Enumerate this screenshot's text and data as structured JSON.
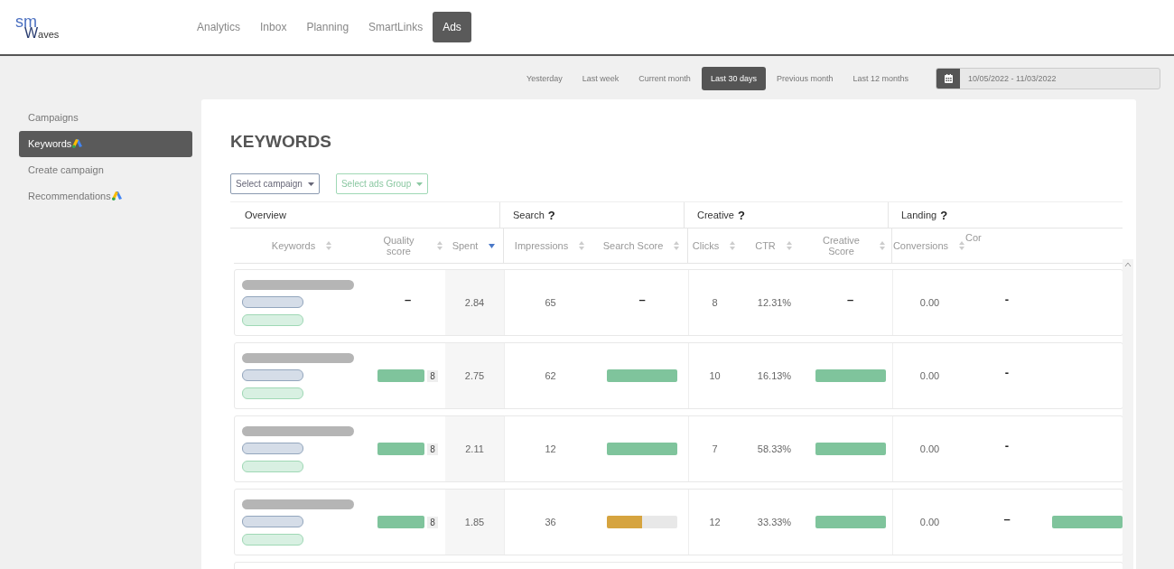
{
  "logo": {
    "top": "sm",
    "bottom": "aves",
    "initial": "W"
  },
  "nav": [
    {
      "label": "Analytics",
      "selected": false
    },
    {
      "label": "Inbox",
      "selected": false
    },
    {
      "label": "Planning",
      "selected": false
    },
    {
      "label": "SmartLinks",
      "selected": false
    },
    {
      "label": "Ads",
      "selected": true
    }
  ],
  "date_filters": [
    {
      "label": "Yesterday",
      "selected": false
    },
    {
      "label": "Last week",
      "selected": false
    },
    {
      "label": "Current month",
      "selected": false
    },
    {
      "label": "Last 30 days",
      "selected": true
    },
    {
      "label": "Previous month",
      "selected": false
    },
    {
      "label": "Last 12 months",
      "selected": false
    }
  ],
  "date_range": {
    "value": "10/05/2022 - 11/03/2022"
  },
  "sidebar": {
    "items": [
      {
        "label": "Campaigns",
        "selected": false,
        "ads_badge": false
      },
      {
        "label": "Keywords",
        "selected": true,
        "ads_badge": true
      },
      {
        "label": "Create campaign",
        "selected": false,
        "ads_badge": false
      },
      {
        "label": "Recommendations",
        "selected": false,
        "ads_badge": true
      }
    ]
  },
  "page_title": "KEYWORDS",
  "filters": [
    {
      "label": "Select campaign",
      "kind": "campaign"
    },
    {
      "label": "Select ads Group",
      "kind": "group"
    }
  ],
  "table": {
    "groups": [
      {
        "label": "Overview"
      },
      {
        "label": "Search",
        "help": "?"
      },
      {
        "label": "Creative",
        "help": "?"
      },
      {
        "label": "Landing",
        "help": "?"
      }
    ],
    "columns": [
      {
        "label": "Keywords",
        "sorted": false
      },
      {
        "label": "Quality score",
        "sorted": false
      },
      {
        "label": "Spent",
        "sorted": true
      },
      {
        "label": "Impressions",
        "sorted": false
      },
      {
        "label": "Search Score",
        "sorted": false
      },
      {
        "label": "Clicks",
        "sorted": false
      },
      {
        "label": "CTR",
        "sorted": false
      },
      {
        "label": "Creative Score",
        "sorted": false
      },
      {
        "label": "Conversions",
        "sorted": false
      },
      {
        "label": "Cor"
      }
    ],
    "rows": [
      {
        "quality": {
          "kind": "dash",
          "text": "–"
        },
        "spent": "2.84",
        "impressions": "65",
        "search_score": {
          "kind": "dash",
          "text": "–"
        },
        "clicks": "8",
        "ctr": "12.31%",
        "creative_score": {
          "kind": "dash",
          "text": "–"
        },
        "conversions": "0.00",
        "column_10": {
          "kind": "dash",
          "text": "-"
        },
        "column_11": {
          "kind": "none"
        }
      },
      {
        "quality": {
          "kind": "bar",
          "level": 1,
          "text": "8",
          "color": "#7fc49c"
        },
        "spent": "2.75",
        "impressions": "62",
        "search_score": {
          "kind": "bar",
          "level": 1,
          "color": "#7fc49c"
        },
        "clicks": "10",
        "ctr": "16.13%",
        "creative_score": {
          "kind": "bar",
          "level": 1,
          "color": "#7fc49c"
        },
        "conversions": "0.00",
        "column_10": {
          "kind": "dash",
          "text": "-"
        },
        "column_11": {
          "kind": "none"
        }
      },
      {
        "quality": {
          "kind": "bar",
          "level": 1,
          "text": "8",
          "color": "#7fc49c"
        },
        "spent": "2.11",
        "impressions": "12",
        "search_score": {
          "kind": "bar",
          "level": 1,
          "color": "#7fc49c"
        },
        "clicks": "7",
        "ctr": "58.33%",
        "creative_score": {
          "kind": "bar",
          "level": 1,
          "color": "#7fc49c"
        },
        "conversions": "0.00",
        "column_10": {
          "kind": "dash",
          "text": "-"
        },
        "column_11": {
          "kind": "none"
        }
      },
      {
        "quality": {
          "kind": "bar",
          "level": 1,
          "text": "8",
          "color": "#7fc49c"
        },
        "spent": "1.85",
        "impressions": "36",
        "search_score": {
          "kind": "bar",
          "level": 0.5,
          "color": "#d6a43f"
        },
        "clicks": "12",
        "ctr": "33.33%",
        "creative_score": {
          "kind": "bar",
          "level": 1,
          "color": "#7fc49c"
        },
        "conversions": "0.00",
        "column_10": {
          "kind": "dash",
          "text": "–"
        },
        "column_11": {
          "kind": "bar",
          "level": 1,
          "color": "#7fc49c"
        }
      }
    ]
  }
}
